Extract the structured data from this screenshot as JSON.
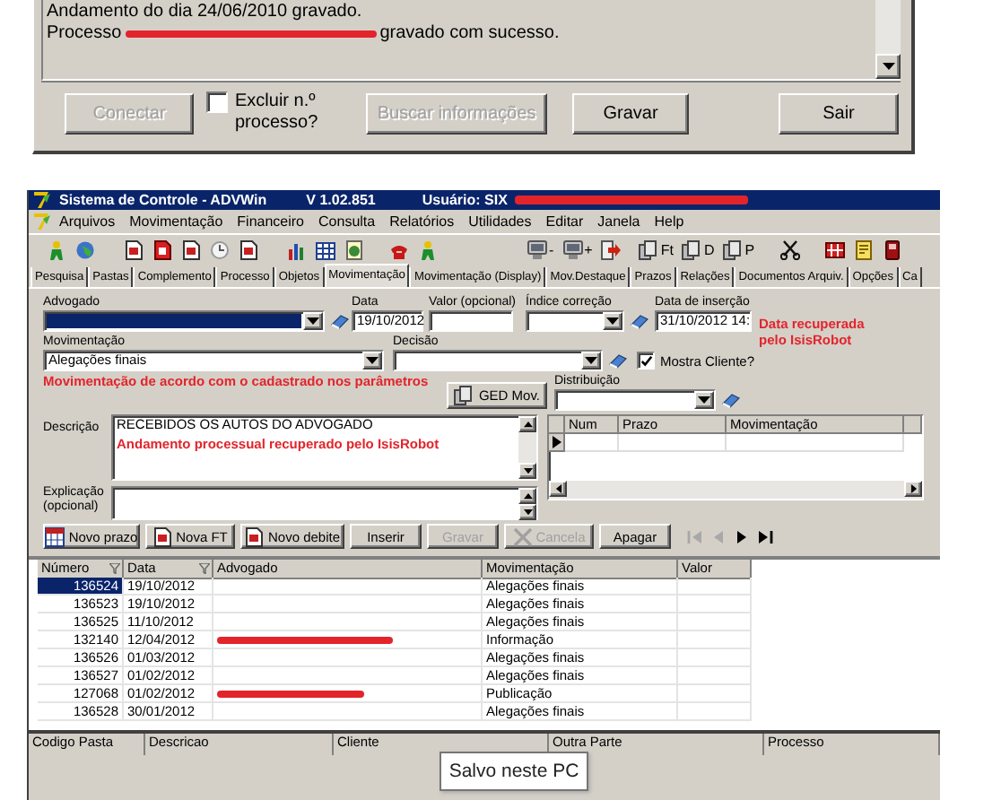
{
  "dialog": {
    "log_lines": [
      [
        {
          "kind": "text",
          "text": "Andamento do dia 24/06/2010 gravado."
        }
      ],
      [
        {
          "kind": "text",
          "text": "Processo"
        },
        {
          "kind": "redaction"
        },
        {
          "kind": "text",
          "text": "gravado com sucesso."
        }
      ]
    ],
    "controls": [
      {
        "kind": "button",
        "label": "Conectar",
        "disabled": true
      },
      {
        "kind": "checkbox",
        "label": "Excluir n.º processo?",
        "checked": false
      },
      {
        "kind": "button",
        "label": "Buscar informações",
        "disabled": true
      },
      {
        "kind": "button",
        "label": "Gravar",
        "disabled": false
      },
      {
        "kind": "button",
        "label": "Sair",
        "disabled": false
      }
    ]
  },
  "window": {
    "title": "Sistema de Controle - ADVWin",
    "version": "V 1.02.851",
    "user": "Usuário: SIX",
    "user_redacted": true
  },
  "menu": [
    "Arquivos",
    "Movimentação",
    "Financeiro",
    "Consulta",
    "Relatórios",
    "Utilidades",
    "Editar",
    "Janela",
    "Help"
  ],
  "toolbar": [
    [
      {
        "kind": "icon"
      },
      {
        "kind": "icon"
      }
    ],
    [
      {
        "kind": "icon"
      },
      {
        "kind": "icon"
      },
      {
        "kind": "icon"
      },
      {
        "kind": "icon"
      },
      {
        "kind": "icon"
      }
    ],
    [
      {
        "kind": "icon"
      },
      {
        "kind": "icon"
      },
      {
        "kind": "icon"
      }
    ],
    [
      {
        "kind": "icon"
      },
      {
        "kind": "icon"
      }
    ],
    [
      {
        "kind": "icon_text",
        "label": "-"
      },
      {
        "kind": "icon_text",
        "label": "+"
      },
      {
        "kind": "icon"
      }
    ],
    [
      {
        "kind": "icon_text",
        "label": "Ft"
      },
      {
        "kind": "icon_text",
        "label": "D"
      },
      {
        "kind": "icon_text",
        "label": "P"
      }
    ],
    [
      {
        "kind": "icon"
      }
    ],
    [
      {
        "kind": "icon"
      },
      {
        "kind": "icon"
      },
      {
        "kind": "icon"
      }
    ]
  ],
  "tabs": [
    {
      "label": "Pesquisa",
      "selected": false
    },
    {
      "label": "Pastas",
      "selected": false
    },
    {
      "label": "Complemento",
      "selected": false
    },
    {
      "label": "Processo",
      "selected": false
    },
    {
      "label": "Objetos",
      "selected": false
    },
    {
      "label": "Movimentação",
      "selected": true
    },
    {
      "label": "Movimentação (Display)",
      "selected": false
    },
    {
      "label": "Mov.Destaque",
      "selected": false
    },
    {
      "label": "Prazos",
      "selected": false
    },
    {
      "label": "Relações",
      "selected": false
    },
    {
      "label": "Documentos Arquiv.",
      "selected": false
    },
    {
      "label": "Opções",
      "selected": false
    },
    {
      "label": "Ca",
      "selected": false
    }
  ],
  "form": {
    "advogado": {
      "label": "Advogado",
      "highlighted": true
    },
    "data": {
      "label": "Data",
      "value": "19/10/2012"
    },
    "valor": {
      "label": "Valor (opcional)"
    },
    "indice": {
      "label": "Índice correção"
    },
    "data_insercao": {
      "label": "Data de inserção",
      "value": "31/10/2012 14:"
    },
    "movimentacao": {
      "label": "Movimentação",
      "value": "Alegações finais"
    },
    "decisao": {
      "label": "Decisão"
    },
    "mostra_cliente": {
      "label": "Mostra Cliente?",
      "checked": true
    },
    "ged_button": "GED Mov.",
    "distribuicao": {
      "label": "Distribuição"
    },
    "descricao": {
      "label": "Descrição",
      "value": "RECEBIDOS OS AUTOS DO ADVOGADO"
    },
    "explicacao": {
      "label": "Explicação (opcional)"
    },
    "prazos_grid": {
      "columns": [
        "Num",
        "Prazo",
        "Movimentação"
      ]
    }
  },
  "annotations": [
    "Data recuperada pelo IsisRobot",
    "Movimentação de acordo com o cadastrado nos parâmetros",
    "Andamento processual recuperado pelo IsisRobot"
  ],
  "action_buttons": [
    {
      "kind": "icon_text",
      "label": "Novo prazo",
      "disabled": false
    },
    {
      "kind": "icon_text",
      "label": "Nova FT",
      "disabled": false
    },
    {
      "kind": "icon_text",
      "label": "Novo debite",
      "disabled": false
    },
    {
      "kind": "text",
      "label": "Inserir",
      "disabled": false
    },
    {
      "kind": "text",
      "label": "Gravar",
      "disabled": true
    },
    {
      "kind": "icon_text",
      "label": "Cancela",
      "disabled": true
    },
    {
      "kind": "text",
      "label": "Apagar",
      "disabled": false
    }
  ],
  "navigator": [
    {
      "kind": "first",
      "disabled": true
    },
    {
      "kind": "prior",
      "disabled": true
    },
    {
      "kind": "next",
      "disabled": false
    },
    {
      "kind": "last",
      "disabled": false
    }
  ],
  "table": {
    "columns": [
      {
        "label": "Número",
        "filter": true
      },
      {
        "label": "Data",
        "filter": true
      },
      {
        "label": "Advogado",
        "filter": false
      },
      {
        "label": "Movimentação",
        "filter": false
      },
      {
        "label": "Valor",
        "filter": false
      }
    ],
    "rows": [
      {
        "numero": "136524",
        "data": "19/10/2012",
        "advogado_redacted": false,
        "movimentacao": "Alegações finais",
        "selected": true
      },
      {
        "numero": "136523",
        "data": "19/10/2012",
        "advogado_redacted": false,
        "movimentacao": "Alegações finais",
        "selected": false
      },
      {
        "numero": "136525",
        "data": "11/10/2012",
        "advogado_redacted": false,
        "movimentacao": "Alegações finais",
        "selected": false
      },
      {
        "numero": "132140",
        "data": "12/04/2012",
        "advogado_redacted": true,
        "movimentacao": "Informação",
        "selected": false
      },
      {
        "numero": "136526",
        "data": "01/03/2012",
        "advogado_redacted": false,
        "movimentacao": "Alegações finais",
        "selected": false
      },
      {
        "numero": "136527",
        "data": "01/02/2012",
        "advogado_redacted": false,
        "movimentacao": "Alegações finais",
        "selected": false
      },
      {
        "numero": "127068",
        "data": "01/02/2012",
        "advogado_redacted": true,
        "movimentacao": "Publicação",
        "selected": false
      },
      {
        "numero": "136528",
        "data": "30/01/2012",
        "advogado_redacted": false,
        "movimentacao": "Alegações finais",
        "selected": false
      }
    ]
  },
  "bottom_grid": {
    "columns": [
      "Codigo Pasta",
      "Descricao",
      "Cliente",
      "Outra Parte",
      "Processo"
    ]
  },
  "tooltip": "Salvo neste PC"
}
